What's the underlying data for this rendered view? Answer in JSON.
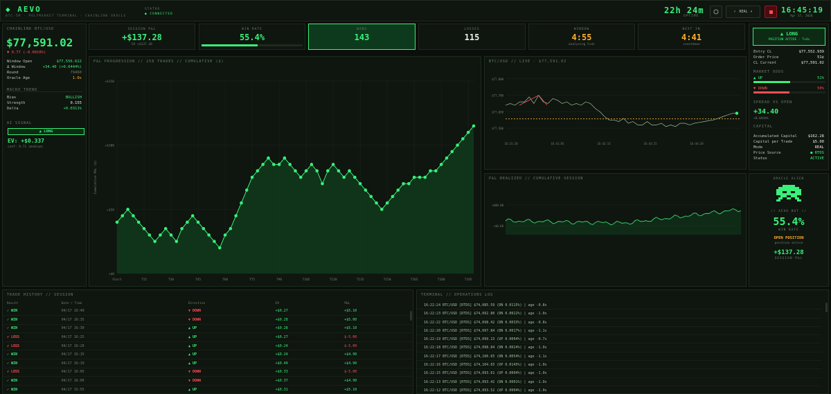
{
  "header": {
    "logo": "AEVO",
    "subnav": "BTC-5M  ·  POLYMARKET TERMINAL  ·  CHAINLINK ORACLE",
    "status_label": "STATUS",
    "status_value": "● CONNECTED",
    "uptime": "22h 24m",
    "uptime_label": "UPTIME",
    "mode_label": "REAL",
    "clock": "16:45:19",
    "date": "Apr 17, 2026"
  },
  "left": {
    "title": "CHAINLINK BTC/USD",
    "price": "$77,591.02",
    "change": "▼ 0.77 (-0.0010%)",
    "rows": [
      {
        "k": "Window Open",
        "v": "$77,556.622",
        "c": "green"
      },
      {
        "k": "Δ Window",
        "v": "+34.40 (+0.0444%)",
        "c": "green"
      },
      {
        "k": "Round",
        "v": "79460",
        "c": "muted"
      },
      {
        "k": "Oracle Age",
        "v": "1.0s",
        "c": "amber"
      }
    ],
    "macro_title": "MACRO TREND",
    "macro": [
      {
        "k": "Bias",
        "v": "BULLISH",
        "c": "green"
      },
      {
        "k": "Strength",
        "v": "0.155",
        "c": "white"
      },
      {
        "k": "Delta",
        "v": "+0.0311%",
        "c": "green"
      }
    ],
    "ai_title": "AI SIGNAL",
    "ai_signal": "▲ LONG",
    "ev": "EV: +$0.337",
    "ev_sub": "conf: 0.71 (medium)"
  },
  "cards": [
    {
      "label": "SESSION P&L",
      "value": "+$137.28",
      "sub": "EV +$137.28",
      "c": "green"
    },
    {
      "label": "WIN RATE",
      "value": "55.4%",
      "sub": "",
      "c": "green",
      "progress": 0.554
    },
    {
      "label": "WINS",
      "value": "143",
      "sub": "",
      "c": "green"
    },
    {
      "label": "LOSSES",
      "value": "115",
      "sub": "",
      "c": "white"
    },
    {
      "label": "WINDOW",
      "value": "4:55",
      "sub": "analysing 5+4s",
      "c": "amber"
    },
    {
      "label": "NEXT IN",
      "value": "4:41",
      "sub": "countdown",
      "c": "amber"
    }
  ],
  "position": {
    "button": "▲ LONG",
    "button_sub": "POSITION ACTIVE · T+4s",
    "rows": [
      {
        "k": "Entry CL",
        "v": "$77,552.939",
        "c": "white"
      },
      {
        "k": "Order Price",
        "v": "51¢",
        "c": "white"
      },
      {
        "k": "CL Current",
        "v": "$77,591.02",
        "c": "white"
      }
    ],
    "odds_title": "MARKET ODDS",
    "odds_up_label": "▲ UP",
    "odds_up": "51%",
    "odds_up_frac": 0.51,
    "odds_down_label": "▼ DOWN",
    "odds_down": "50%",
    "odds_down_frac": 0.5,
    "spread_title": "SPREAD VS OPEN",
    "spread": "+34.40",
    "spread_sub": "+0.0444%",
    "capital_title": "CAPITAL",
    "capital": [
      {
        "k": "Accumulated Capital",
        "v": "$162.28",
        "c": "white"
      },
      {
        "k": "Capital per Trade",
        "v": "$5.00",
        "c": "white"
      },
      {
        "k": "Mode",
        "v": "REAL",
        "c": "white"
      },
      {
        "k": "Price Source",
        "v": "● RTDS",
        "c": "green"
      },
      {
        "k": "Status",
        "v": "ACTIVE",
        "c": "green"
      }
    ]
  },
  "oracle": {
    "title": "ORACLE ALIEN",
    "sub": "// AEVO BOT //",
    "win_rate": "55.4%",
    "win_rate_label": "WIN RATE",
    "open": "OPEN POSITION",
    "open_sub": "position active",
    "pnl": "+$137.28",
    "pnl_label": "SESSION P&L"
  },
  "pnl_chart": {
    "title": "P&L PROGRESSION // 258 TRADES // CUMULATIVE ($)",
    "ylabel": "Cumulative P&L ($)",
    "yticks": [
      "+$150",
      "+$100",
      "+$50",
      "+$0"
    ],
    "xticks": [
      "Start",
      "T15",
      "T30",
      "T45",
      "T60",
      "T75",
      "T90",
      "T105",
      "T120",
      "T135",
      "T150",
      "T165",
      "T180",
      "T195"
    ]
  },
  "btc_chart": {
    "title": "BTC/USD // LIVE · $77,591.02",
    "yticks": [
      "$77,800",
      "$77,700",
      "$77,600",
      "$77,500"
    ],
    "xticks": [
      "16:31:20",
      "16:41:05",
      "16:42:15",
      "16:43:15",
      "16:44:20"
    ]
  },
  "real_chart": {
    "title": "P&L REALIZED // CUMULATIVE SESSION",
    "yticks": [
      "+$00.00",
      "+$0.00"
    ]
  },
  "chart_data": [
    {
      "type": "line",
      "title": "P&L PROGRESSION // 258 TRADES // CUMULATIVE ($)",
      "ylabel": "Cumulative P&L ($)",
      "ylim": [
        0,
        150
      ],
      "x": [
        0,
        3,
        6,
        9,
        12,
        15,
        18,
        21,
        24,
        27,
        30,
        33,
        36,
        39,
        42,
        45,
        48,
        51,
        54,
        57,
        60,
        63,
        66,
        69,
        72,
        75,
        78,
        81,
        84,
        87,
        90,
        93,
        96,
        99,
        102,
        105,
        108,
        111,
        114,
        117,
        120,
        123,
        126,
        129,
        132,
        135,
        138,
        141,
        144,
        147,
        150,
        153,
        156,
        159,
        162,
        165,
        168,
        171,
        174,
        177,
        180,
        183,
        186,
        189,
        192,
        195,
        198
      ],
      "y": [
        40,
        45,
        50,
        45,
        40,
        35,
        30,
        25,
        30,
        35,
        30,
        25,
        35,
        40,
        45,
        40,
        35,
        30,
        25,
        20,
        30,
        35,
        45,
        55,
        65,
        75,
        80,
        85,
        90,
        85,
        85,
        90,
        85,
        80,
        75,
        80,
        85,
        80,
        70,
        80,
        85,
        80,
        75,
        80,
        75,
        70,
        65,
        60,
        55,
        50,
        55,
        60,
        65,
        70,
        70,
        75,
        75,
        75,
        80,
        80,
        85,
        90,
        95,
        100,
        105,
        110,
        115
      ],
      "grid": true
    },
    {
      "type": "line",
      "title": "BTC/USD // LIVE · $77,591.02",
      "x": [
        "16:31:20",
        "16:41:05",
        "16:42:15",
        "16:43:15",
        "16:44:20"
      ],
      "y": [
        77640,
        77680,
        77560,
        77520,
        77591
      ],
      "reference_line": 77556.62
    }
  ],
  "history": {
    "title": "TRADE HISTORY // SESSION",
    "cols": [
      "Result",
      "Date / Time",
      "Direction",
      "EV",
      "P&L"
    ],
    "rows": [
      [
        "✓ WIN",
        "04/17 16:40",
        "▼ DOWN",
        "+$0.27",
        "+$5.10"
      ],
      [
        "✓ WIN",
        "04/17 16:35",
        "▼ DOWN",
        "+$0.28",
        "+$5.00"
      ],
      [
        "✓ WIN",
        "04/17 16:30",
        "▲ UP",
        "+$0.28",
        "+$5.10"
      ],
      [
        "✗ LOSS",
        "04/17 16:25",
        "▲ UP",
        "+$0.27",
        "$-5.00"
      ],
      [
        "✗ LOSS",
        "04/17 16:20",
        "▲ UP",
        "+$0.24",
        "$-5.00"
      ],
      [
        "✓ WIN",
        "04/17 16:15",
        "▲ UP",
        "+$0.24",
        "+$4.90"
      ],
      [
        "✓ WIN",
        "04/17 16:10",
        "▲ UP",
        "+$0.40",
        "+$4.90"
      ],
      [
        "✗ LOSS",
        "04/17 16:05",
        "▼ DOWN",
        "+$0.33",
        "$-5.00"
      ],
      [
        "✓ WIN",
        "04/17 16:00",
        "▼ DOWN",
        "+$0.37",
        "+$4.90"
      ],
      [
        "✓ WIN",
        "04/17 15:55",
        "▲ UP",
        "+$0.31",
        "+$5.10"
      ]
    ]
  },
  "oplog": {
    "title": "TERMINAL // OPERATIONS LOG",
    "lines": [
      "16:22:24 BTC/USD [RTDS] $74,085.59 (DN 0.0115%) | age -0.8s",
      "16:22:23 BTC/USD [RTDS] $74,092.80 (DN 0.0022%) | age -1.0s",
      "16:22:22 BTC/USD [RTDS] $74,098.42 (DN 0.0033%) | age -0.8s",
      "16:22:20 BTC/USD [RTDS] $74,097.84 (DN 0.0017%) | age -1.1s",
      "16:22:19 BTC/USD [RTDS] $74,099.13 (UP 0.0004%) | age -0.7s",
      "16:22:18 BTC/USD [RTDS] $74,098.84 (DN 0.0024%) | age -1.0s",
      "16:22:17 BTC/USD [RTDS] $74,100.65 (DN 0.0054%) | age -1.1s",
      "16:22:16 BTC/USD [RTDS] $74,104.65 (UP 0.0145%) | age -1.0s",
      "16:22:15 BTC/USD [RTDS] $74,093.61 (UP 0.0004%) | age -1.0s",
      "16:22:13 BTC/USD [RTDS] $74,093.42 (DN 0.0001%) | age -1.0s",
      "16:22:12 BTC/USD [RTDS] $74,093.52 (UP 0.0004%) | age -1.0s"
    ]
  }
}
